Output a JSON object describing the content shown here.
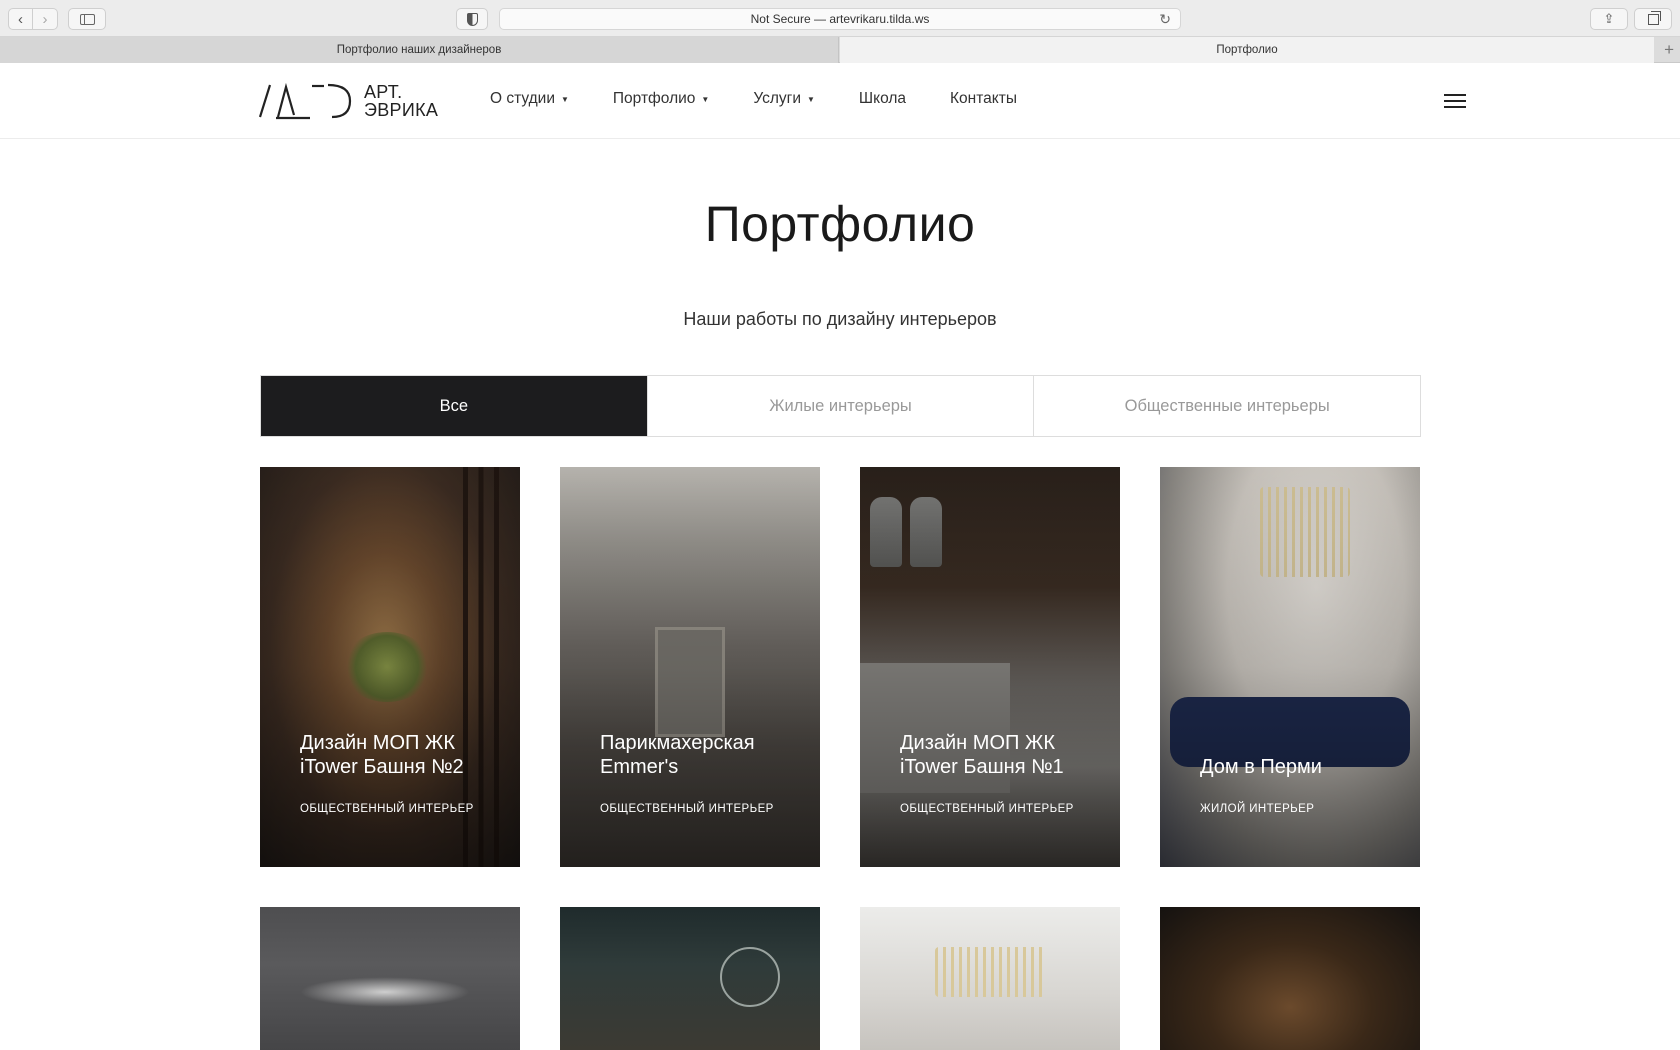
{
  "browser": {
    "url": "Not Secure — artevrikaru.tilda.ws",
    "tabs": [
      {
        "label": "Портфолио наших дизайнеров"
      },
      {
        "label": "Портфолио"
      }
    ]
  },
  "header": {
    "logo_line1": "АРТ.",
    "logo_line2": "ЭВРИКА",
    "menu": [
      {
        "label": "О студии",
        "dropdown": true
      },
      {
        "label": "Портфолио",
        "dropdown": true
      },
      {
        "label": "Услуги",
        "dropdown": true
      },
      {
        "label": "Школа",
        "dropdown": false
      },
      {
        "label": "Контакты",
        "dropdown": false
      }
    ],
    "caret": "▼"
  },
  "page": {
    "title": "Портфолио",
    "subtitle": "Наши работы по дизайну интерьеров"
  },
  "filters": [
    {
      "label": "Все",
      "active": true
    },
    {
      "label": "Жилые интерьеры",
      "active": false
    },
    {
      "label": "Общественные интерьеры",
      "active": false
    }
  ],
  "cards": [
    {
      "title": "Дизайн МОП ЖК iTower Башня №2",
      "tag": "Общественный интерьер"
    },
    {
      "title": "Парикмахерская Emmer's",
      "tag": "Общественный интерьер"
    },
    {
      "title": "Дизайн МОП ЖК iTower Башня №1",
      "tag": "Общественный интерьер"
    },
    {
      "title": "Дом в Перми",
      "tag": "Жилой интерьер"
    },
    {
      "title": "",
      "tag": ""
    },
    {
      "title": "",
      "tag": ""
    },
    {
      "title": "",
      "tag": ""
    },
    {
      "title": "",
      "tag": ""
    }
  ],
  "colors": {
    "active_filter_bg": "#1c1c1e",
    "text": "#222222"
  }
}
